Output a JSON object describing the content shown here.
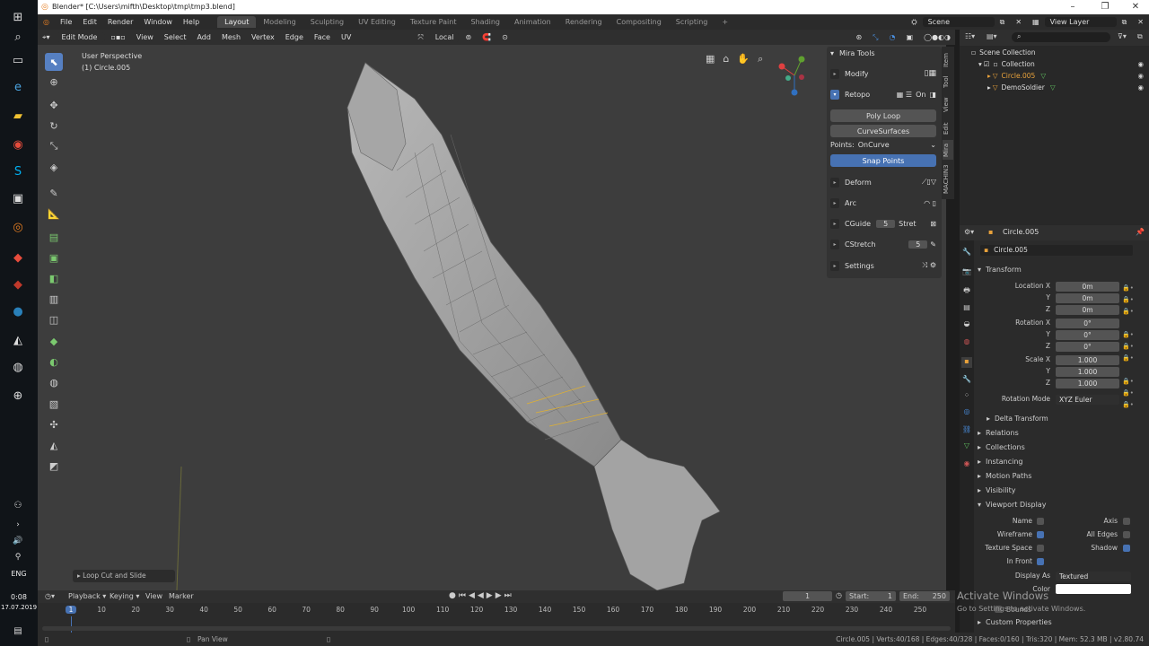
{
  "window": {
    "title": "Blender* [C:\\Users\\mifth\\Desktop\\tmp\\tmp3.blend]"
  },
  "menu": [
    "File",
    "Edit",
    "Render",
    "Window",
    "Help"
  ],
  "workspaces": [
    {
      "label": "Layout",
      "active": true
    },
    {
      "label": "Modeling"
    },
    {
      "label": "Sculpting"
    },
    {
      "label": "UV Editing"
    },
    {
      "label": "Texture Paint"
    },
    {
      "label": "Shading"
    },
    {
      "label": "Animation"
    },
    {
      "label": "Rendering"
    },
    {
      "label": "Compositing"
    },
    {
      "label": "Scripting"
    }
  ],
  "scene": {
    "name": "Scene",
    "view_layer": "View Layer"
  },
  "viewport_header": {
    "mode": "Edit Mode",
    "menus": [
      "View",
      "Select",
      "Add",
      "Mesh",
      "Vertex",
      "Edge",
      "Face",
      "UV"
    ],
    "orientation": "Local"
  },
  "viewport": {
    "perspective": "User Perspective",
    "object": "(1) Circle.005",
    "last_op": "Loop Cut and Slide"
  },
  "mira": {
    "title": "Mira Tools",
    "rows": [
      {
        "label": "Modify"
      },
      {
        "label": "Retopo",
        "value": "On"
      },
      {
        "label": "Poly Loop"
      },
      {
        "label": "CurveSurfaces"
      },
      {
        "label": "Points:",
        "value": "OnCurve"
      },
      {
        "label": "Snap Points"
      },
      {
        "label": "Deform"
      },
      {
        "label": "Arc"
      },
      {
        "label": "CGuide",
        "value": "5",
        "extra": "Stret"
      },
      {
        "label": "CStretch",
        "value": "5"
      },
      {
        "label": "Settings"
      }
    ],
    "vtabs": [
      "Item",
      "Tool",
      "View",
      "Edit",
      "Mira",
      "MACHIN3"
    ]
  },
  "outliner": {
    "items": [
      {
        "label": "Scene Collection",
        "icon": "collection-icon"
      },
      {
        "label": "Collection",
        "icon": "collection-icon"
      },
      {
        "label": "Circle.005",
        "icon": "mesh-icon",
        "active": true
      },
      {
        "label": "DemoSoldier",
        "icon": "mesh-icon"
      }
    ]
  },
  "properties": {
    "object": "Circle.005",
    "data_name": "Circle.005",
    "transform": {
      "title": "Transform",
      "location": {
        "label": "Location X",
        "x": "0m",
        "y": "0m",
        "z": "0m"
      },
      "rotation": {
        "label": "Rotation X",
        "x": "0°",
        "y": "0°",
        "z": "0°"
      },
      "scale": {
        "label": "Scale X",
        "x": "1.000",
        "y": "1.000",
        "z": "1.000"
      },
      "mode_label": "Rotation Mode",
      "mode": "XYZ Euler",
      "delta": "Delta Transform",
      "y": "Y",
      "z": "Z"
    },
    "sections": [
      "Relations",
      "Collections",
      "Instancing",
      "Motion Paths",
      "Visibility"
    ],
    "viewport_display": {
      "title": "Viewport Display",
      "name": "Name",
      "axis": "Axis",
      "wireframe": "Wireframe",
      "all_edges": "All Edges",
      "texture_space": "Texture Space",
      "shadow": "Shadow",
      "in_front": "In Front",
      "display_as_label": "Display As",
      "display_as": "Textured",
      "color": "Color",
      "bounds": "Bounds",
      "custom": "Custom Properties"
    }
  },
  "timeline": {
    "menus": [
      "Playback",
      "Keying",
      "View",
      "Marker"
    ],
    "frame": "1",
    "start_label": "Start:",
    "start": "1",
    "end_label": "End:",
    "end": "250",
    "ticks": [
      "1",
      "10",
      "20",
      "30",
      "40",
      "50",
      "60",
      "70",
      "80",
      "90",
      "100",
      "110",
      "120",
      "130",
      "140",
      "150",
      "160",
      "170",
      "180",
      "190",
      "200",
      "210",
      "220",
      "230",
      "240",
      "250"
    ]
  },
  "status": {
    "left": "Pan View",
    "right": "Circle.005 | Verts:40/168 | Edges:40/328 | Faces:0/160 | Tris:320 | Mem: 52.3 MB | v2.80.74"
  },
  "watermark": {
    "line1": "Activate Windows",
    "line2": "Go to Settings to activate Windows."
  },
  "os": {
    "lang": "ENG",
    "time": "0:08",
    "date": "17.07.2019"
  }
}
